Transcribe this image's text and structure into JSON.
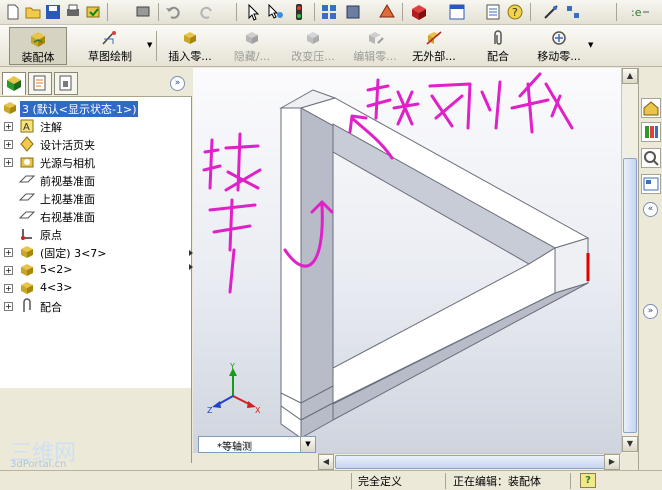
{
  "command_manager": {
    "assembly_tab": "装配体",
    "sketch_tab": "草图绘制",
    "insert_component": "插入零...",
    "hide": "隐藏/...",
    "change_transparency": "改变压...",
    "edit_component": "编辑零...",
    "no_external_refs": "无外部...",
    "mate": "配合",
    "move_component": "移动零..."
  },
  "feature_tree": {
    "root": "3  (默认<显示状态-1>)",
    "items": [
      {
        "label": "注解",
        "icon": "annotation-icon",
        "expandable": true
      },
      {
        "label": "设计活页夹",
        "icon": "design-binder-icon",
        "expandable": true
      },
      {
        "label": "光源与相机",
        "icon": "lights-camera-icon",
        "expandable": true
      },
      {
        "label": "前视基准面",
        "icon": "plane-icon",
        "expandable": false
      },
      {
        "label": "上视基准面",
        "icon": "plane-icon",
        "expandable": false
      },
      {
        "label": "右视基准面",
        "icon": "plane-icon",
        "expandable": false
      },
      {
        "label": "原点",
        "icon": "origin-icon",
        "expandable": false
      },
      {
        "label": "(固定) 3<7>",
        "icon": "part-icon",
        "expandable": true
      },
      {
        "label": "5<2>",
        "icon": "part-icon",
        "expandable": true
      },
      {
        "label": "4<3>",
        "icon": "part-icon",
        "expandable": true
      },
      {
        "label": "配合",
        "icon": "mates-icon",
        "expandable": true
      }
    ]
  },
  "viewport": {
    "view_orientation": "*等轴测",
    "triad": {
      "x": "X",
      "y": "Y",
      "z": "Z"
    }
  },
  "annotations": {
    "top_text": "分割线",
    "left_text": "视觉"
  },
  "status_bar": {
    "status": "完全定义",
    "editing": "正在编辑：装配体",
    "help": "?"
  },
  "watermark": {
    "top": "三维网",
    "bottom": "3dPortal.cn"
  },
  "colors": {
    "selection": "#316ac5",
    "annotation_ink": "#e020c8",
    "model_face": "#ffffff",
    "model_side": "#b8bcc8",
    "highlight_edge": "#e00000"
  }
}
